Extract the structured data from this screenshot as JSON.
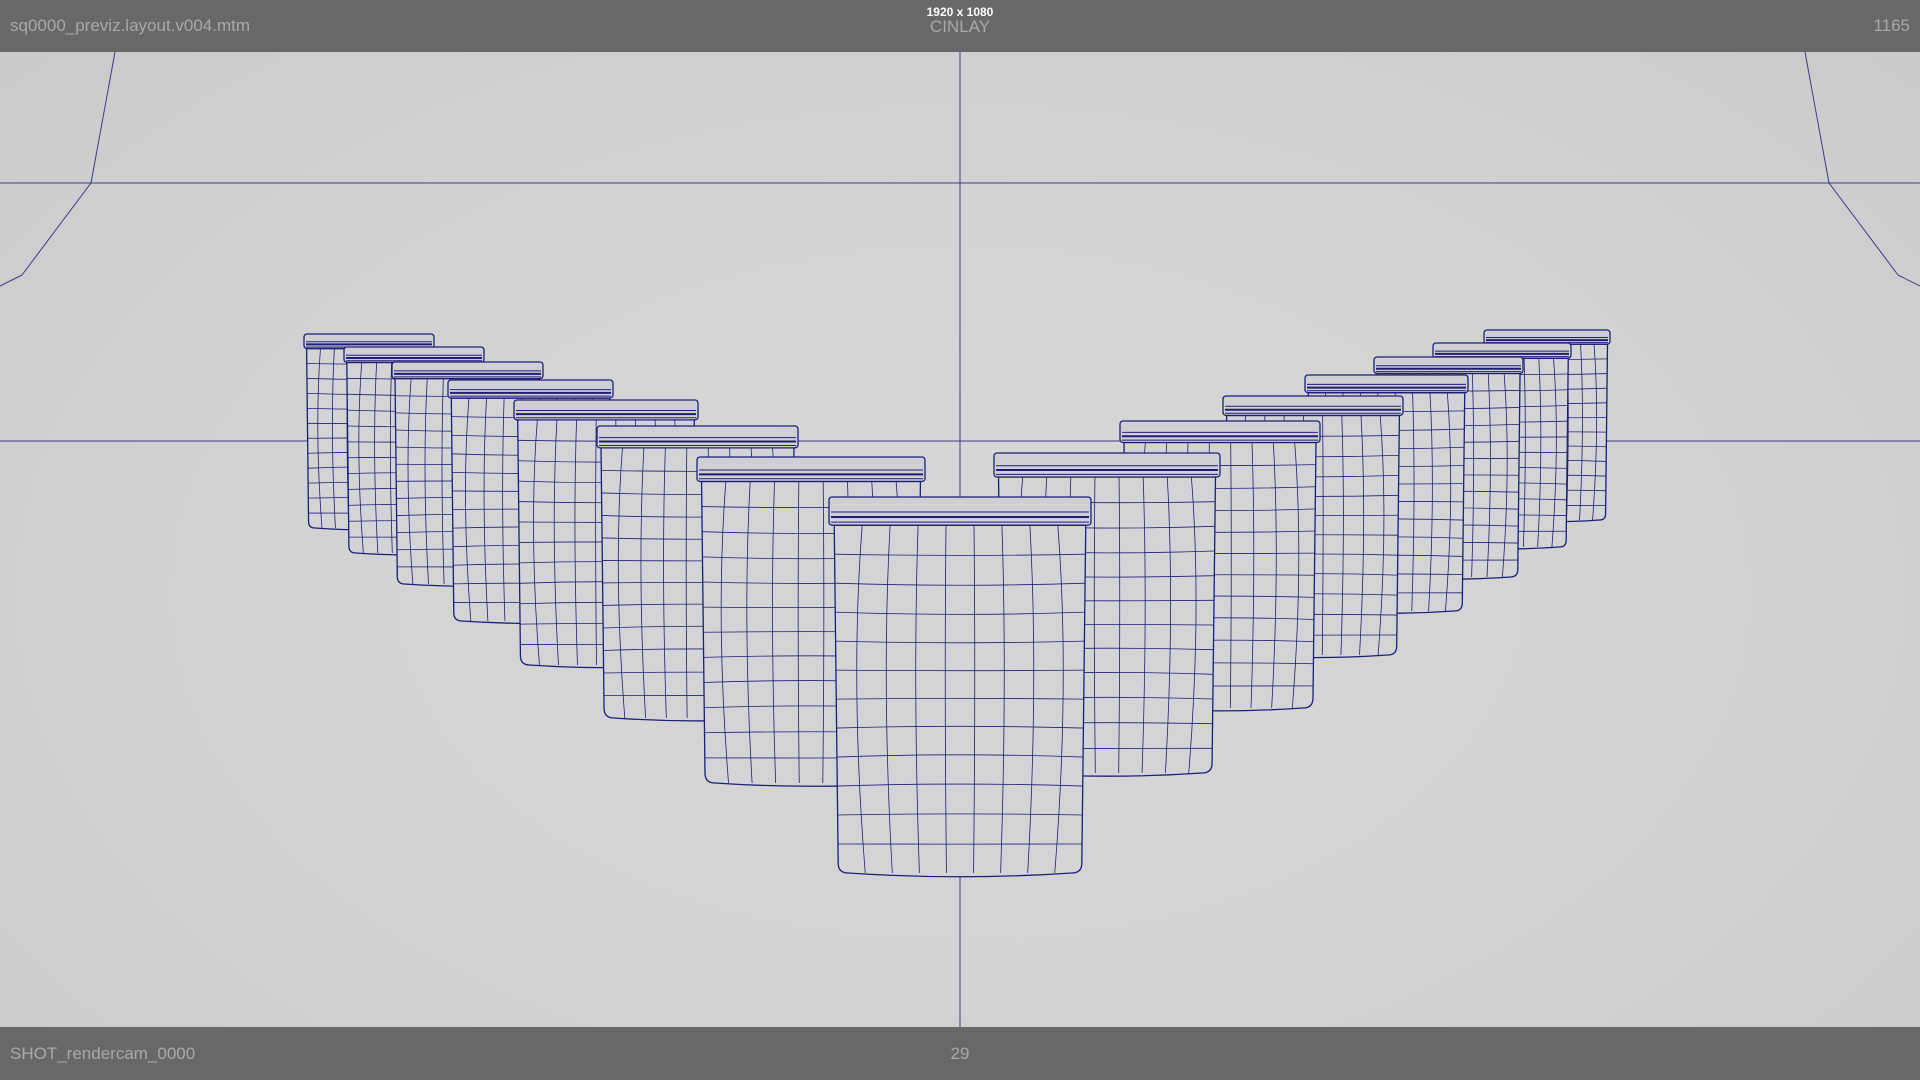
{
  "viewport": {
    "file_name": "sq0000_previz.layout.v004.mtm",
    "resolution": "1920 x 1080",
    "hud_label": "CINLAY",
    "frame_count": "1165",
    "camera_name": "SHOT_rendercam_0000",
    "current_frame": "29"
  },
  "colors": {
    "wireframe": "#1e1e78",
    "guide_lines": "#3a3a8a",
    "hud_bar": "#686868",
    "hud_text": "#a9a9a9",
    "background": "#d3d3d3"
  },
  "scene": {
    "object_type": "wireframe pouch",
    "object_count": 15
  }
}
